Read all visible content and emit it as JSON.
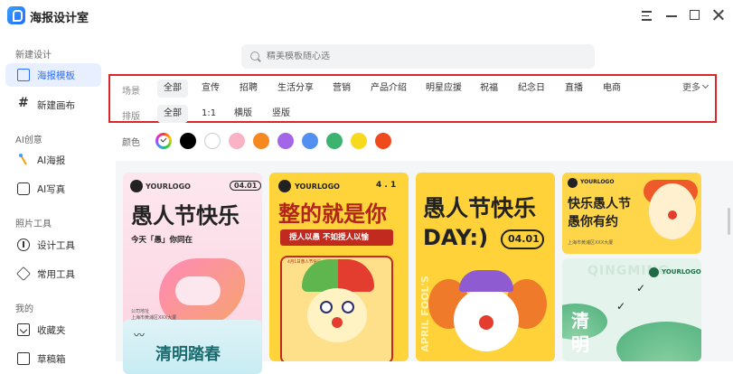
{
  "app": {
    "title": "海报设计室"
  },
  "sidebar": {
    "sections": [
      {
        "label": "新建设计",
        "items": [
          {
            "label": "海报模板",
            "icon": "poster-icon",
            "active": true
          },
          {
            "label": "新建画布",
            "icon": "hash-icon"
          }
        ]
      },
      {
        "label": "AI创意",
        "items": [
          {
            "label": "AI海报",
            "icon": "magic-wand-icon"
          },
          {
            "label": "AI写真",
            "icon": "ai-icon"
          }
        ]
      },
      {
        "label": "照片工具",
        "items": [
          {
            "label": "设计工具",
            "icon": "design-tool-icon"
          },
          {
            "label": "常用工具",
            "icon": "box-icon"
          }
        ]
      },
      {
        "label": "我的",
        "items": [
          {
            "label": "收藏夹",
            "icon": "favorite-folder-icon"
          },
          {
            "label": "草稿箱",
            "icon": "draft-icon"
          }
        ]
      }
    ]
  },
  "search": {
    "placeholder": "精美模板随心选"
  },
  "filters": {
    "scene": {
      "label": "场景",
      "options": [
        "全部",
        "宣传",
        "招聘",
        "生活分享",
        "营销",
        "产品介绍",
        "明星应援",
        "祝福",
        "纪念日",
        "直播",
        "电商"
      ],
      "selected": "全部"
    },
    "layout": {
      "label": "排版",
      "options": [
        "全部",
        "1:1",
        "横版",
        "竖版"
      ],
      "selected": "全部"
    },
    "more_label": "更多"
  },
  "colors": {
    "label": "颜色",
    "swatches": [
      "all",
      "#000000",
      "#ffffff",
      "#f9b3c4",
      "#f5891f",
      "#a466e8",
      "#5190f0",
      "#3cb371",
      "#f7d91e",
      "#ee4a1c"
    ],
    "selected": "all"
  },
  "templates": [
    {
      "logo": "YOURLOGO",
      "date": "04.01",
      "title": "愚人节快乐",
      "subtitle": "今天「愚」你同在",
      "footer": "公司地址\n上海市黄浦区XXX大厦"
    },
    {
      "logo": "YOURLOGO",
      "date": "4 . 1",
      "title": "整的就是你",
      "subtitle": "授人以愚 不如授人以愉",
      "footer": "4月1日愚人节快乐"
    },
    {
      "title": "愚人节快乐",
      "title2": "DAY:)",
      "date": "04.01",
      "side_text": "APRIL FOOL'S"
    },
    {
      "logo": "YOURLOGO",
      "title": "快乐愚人节",
      "title2": "愚你有约",
      "footer": "上海市黄浦区XXX大厦"
    },
    {
      "logo": "YOURLOGO",
      "title": "清明",
      "watermark": "QINGMING"
    },
    {
      "title": "清明踏春"
    }
  ]
}
